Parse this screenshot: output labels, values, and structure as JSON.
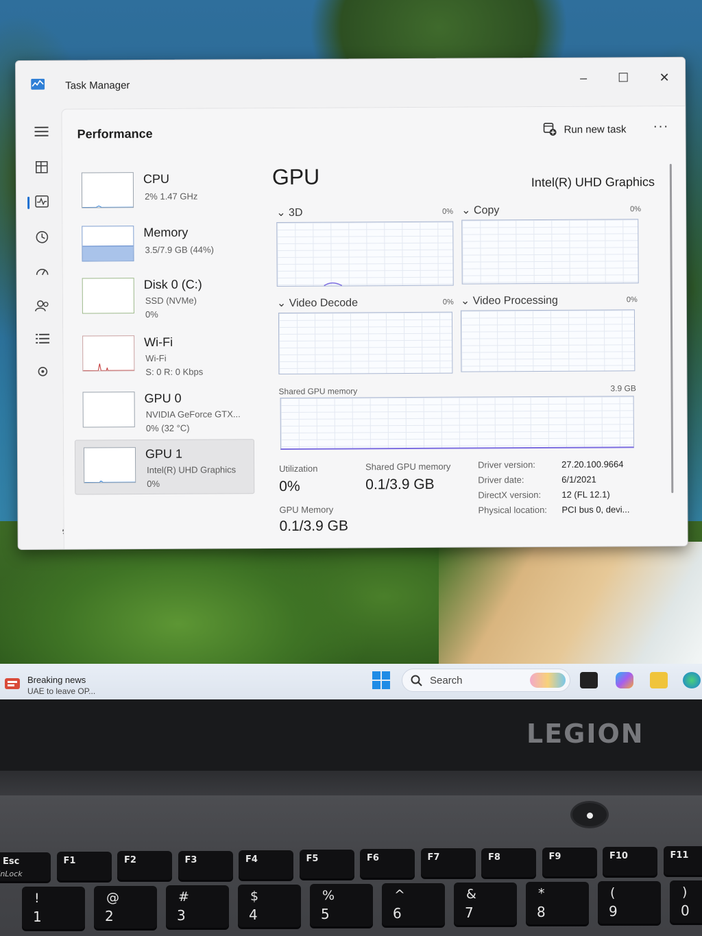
{
  "window": {
    "title": "Task Manager",
    "controls": {
      "minimize": "–",
      "maximize": "☐",
      "close": "✕"
    }
  },
  "rail": {
    "items": [
      {
        "name": "menu",
        "icon": "hamburger-icon"
      },
      {
        "name": "processes",
        "icon": "processes-icon"
      },
      {
        "name": "performance",
        "icon": "performance-icon",
        "active": true
      },
      {
        "name": "app-history",
        "icon": "history-icon"
      },
      {
        "name": "startup-apps",
        "icon": "startup-icon"
      },
      {
        "name": "users",
        "icon": "users-icon"
      },
      {
        "name": "details",
        "icon": "details-icon"
      },
      {
        "name": "services",
        "icon": "services-icon"
      }
    ],
    "settings_icon": "gear-icon"
  },
  "header": {
    "title": "Performance",
    "run_new_task": "Run new task",
    "more": "···"
  },
  "resources": [
    {
      "id": "cpu",
      "name": "CPU",
      "line1": "2%  1.47 GHz",
      "line2": ""
    },
    {
      "id": "memory",
      "name": "Memory",
      "line1": "3.5/7.9 GB (44%)",
      "line2": ""
    },
    {
      "id": "disk",
      "name": "Disk 0 (C:)",
      "line1": "SSD (NVMe)",
      "line2": "0%"
    },
    {
      "id": "wifi",
      "name": "Wi-Fi",
      "line1": "Wi-Fi",
      "line2": "S: 0  R: 0 Kbps"
    },
    {
      "id": "gpu0",
      "name": "GPU 0",
      "line1": "NVIDIA GeForce GTX...",
      "line2": "0%  (32 °C)"
    },
    {
      "id": "gpu1",
      "name": "GPU 1",
      "line1": "Intel(R) UHD Graphics",
      "line2": "0%",
      "selected": true
    }
  ],
  "memory_usage_fraction": 0.44,
  "detail": {
    "title": "GPU",
    "model": "Intel(R) UHD Graphics",
    "engines": [
      {
        "label": "3D",
        "pct": "0%"
      },
      {
        "label": "Copy",
        "pct": "0%"
      },
      {
        "label": "Video Decode",
        "pct": "0%"
      },
      {
        "label": "Video Processing",
        "pct": "0%"
      }
    ],
    "shared_label": "Shared GPU memory",
    "shared_max": "3.9 GB",
    "utilization_label": "Utilization",
    "utilization_value": "0%",
    "shared_mem_label": "Shared GPU memory",
    "shared_mem_value": "0.1/3.9 GB",
    "gpu_mem_label": "GPU Memory",
    "gpu_mem_value": "0.1/3.9 GB",
    "info": [
      {
        "k": "Driver version:",
        "v": "27.20.100.9664"
      },
      {
        "k": "Driver date:",
        "v": "6/1/2021"
      },
      {
        "k": "DirectX version:",
        "v": "12 (FL 12.1)"
      },
      {
        "k": "Physical location:",
        "v": "PCI bus 0, devi..."
      }
    ]
  },
  "taskbar": {
    "news_title": "Breaking news",
    "news_sub": "UAE to leave OP...",
    "search_placeholder": "Search"
  },
  "laptop": {
    "brand": "LEGION",
    "fkeys": [
      {
        "label": "Esc",
        "sub": "FnLock"
      },
      {
        "label": "F1",
        "sub": ""
      },
      {
        "label": "F2",
        "sub": ""
      },
      {
        "label": "F3",
        "sub": ""
      },
      {
        "label": "F4",
        "sub": ""
      },
      {
        "label": "F5",
        "sub": ""
      },
      {
        "label": "F6",
        "sub": ""
      },
      {
        "label": "F7",
        "sub": ""
      },
      {
        "label": "F8",
        "sub": ""
      },
      {
        "label": "F9",
        "sub": ""
      },
      {
        "label": "F10",
        "sub": ""
      },
      {
        "label": "F11",
        "sub": ""
      }
    ],
    "numkeys": [
      {
        "top": "!",
        "bottom": "1"
      },
      {
        "top": "@",
        "bottom": "2"
      },
      {
        "top": "#",
        "bottom": "3"
      },
      {
        "top": "$",
        "bottom": "4"
      },
      {
        "top": "%",
        "bottom": "5"
      },
      {
        "top": "^",
        "bottom": "6"
      },
      {
        "top": "&",
        "bottom": "7"
      },
      {
        "top": "*",
        "bottom": "8"
      },
      {
        "top": "(",
        "bottom": "9"
      },
      {
        "top": ")",
        "bottom": "0"
      }
    ]
  },
  "colors": {
    "accent": "#1a6fd1",
    "graph_border": "#a9b6d1",
    "memory_fill": "#a9c3ea",
    "wifi_spike": "#c03030"
  }
}
